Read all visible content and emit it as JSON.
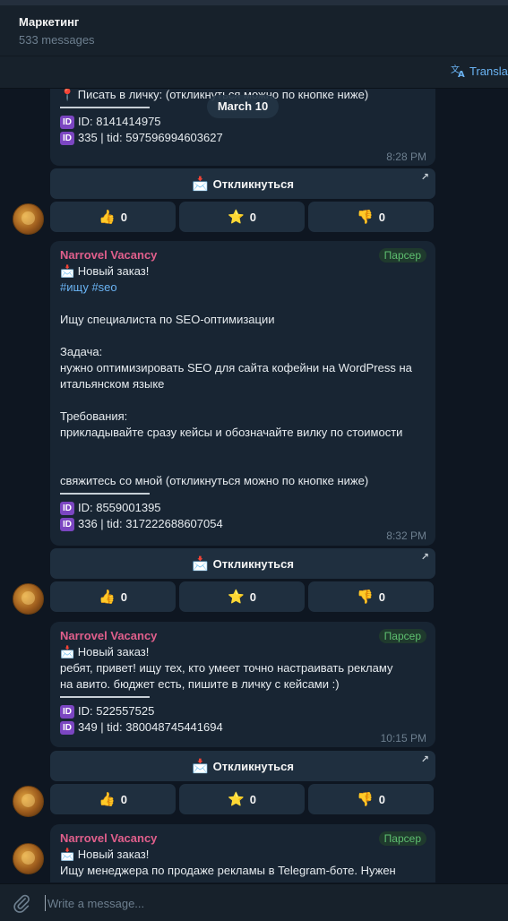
{
  "header": {
    "title": "Маркетинг",
    "subtitle": "533 messages",
    "translate_label": "Transla"
  },
  "date_chip": "March 10",
  "reactions": {
    "like": {
      "emoji": "👍",
      "count": "0"
    },
    "star": {
      "emoji": "⭐",
      "count": "0"
    },
    "dislike": {
      "emoji": "👎",
      "count": "0"
    }
  },
  "action_button": {
    "emoji": "📩",
    "label": "Откликнуться",
    "corner_icon": "↗"
  },
  "messages": [
    {
      "contact_line": "📍 Писать в личку: (откликнуться можно по кнопке ниже)",
      "id_line": "ID: 8141414975",
      "tid_line": "335 | tid: 597596994603627",
      "time": "8:28 PM"
    },
    {
      "sender": "Narrovel Vacancy",
      "badge": "Парсер",
      "order_line": "📩 Новый заказ!",
      "tags": "#ищу #seo",
      "body": [
        "Ищу специалиста по SEO-оптимизации",
        "Задача:",
        "нужно оптимизировать SEO для сайта кофейни на WordPress на",
        "итальянском языке",
        "Требования:",
        "прикладывайте сразу кейсы и обозначайте вилку по стоимости",
        "свяжитесь со мной (откликнуться можно по кнопке ниже)"
      ],
      "id_line": "ID: 8559001395",
      "tid_line": "336 | tid: 317222688607054",
      "time": "8:32 PM"
    },
    {
      "sender": "Narrovel Vacancy",
      "badge": "Парсер",
      "order_line": "📩 Новый заказ!",
      "body": [
        "ребят, привет! ищу тех, кто умеет точно настраивать рекламу",
        "на авито. бюджет есть, пишите в личку с кейсами :)"
      ],
      "id_line": "ID: 522557525",
      "tid_line": "349 | tid: 380048745441694",
      "time": "10:15 PM"
    },
    {
      "sender": "Narrovel Vacancy",
      "badge": "Парсер",
      "order_line": "📩 Новый заказ!",
      "body": [
        "Ищу менеджера по продаже рекламы в Telegram-боте. Нужен"
      ]
    }
  ],
  "input": {
    "placeholder": "Write a message..."
  }
}
